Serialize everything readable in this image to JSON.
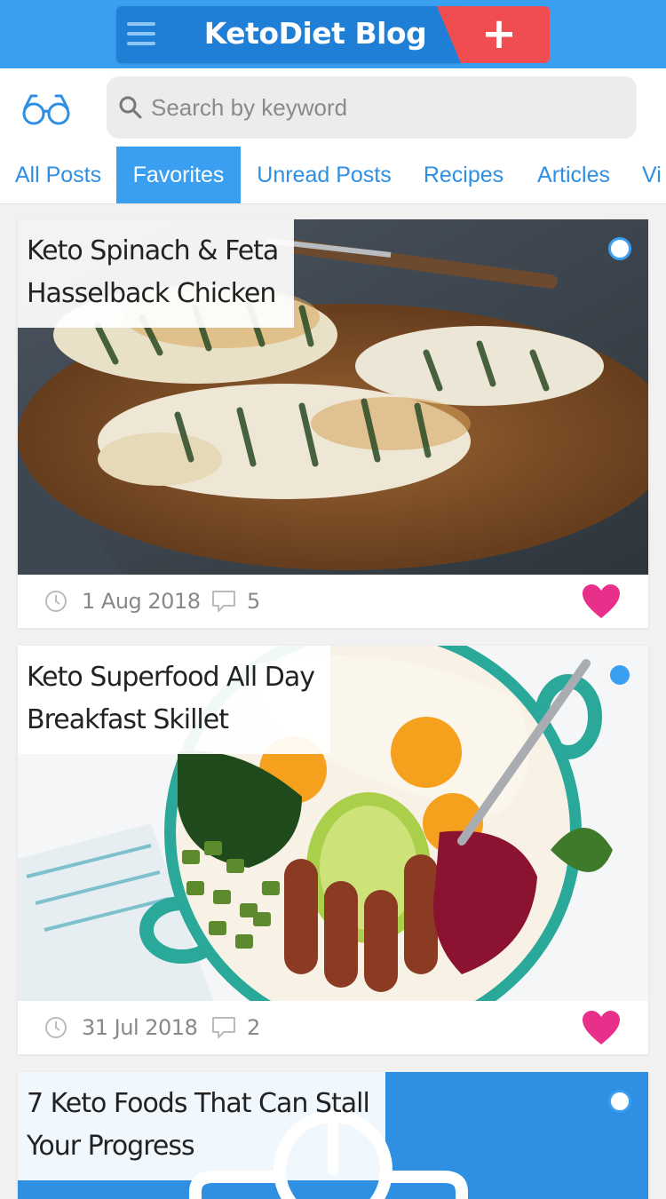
{
  "header": {
    "title": "KetoDiet Blog",
    "add_label": "+",
    "menu_icon": "hamburger-menu-icon",
    "colors": {
      "bar": "#3a9ff0",
      "title_bg": "#1f7fd6",
      "add_bg": "#ef4d50"
    }
  },
  "search": {
    "placeholder": "Search by keyword",
    "value": "",
    "left_icon": "glasses-icon",
    "icon": "search-icon"
  },
  "tabs": [
    {
      "label": "All Posts",
      "active": false
    },
    {
      "label": "Favorites",
      "active": true
    },
    {
      "label": "Unread Posts",
      "active": false
    },
    {
      "label": "Recipes",
      "active": false
    },
    {
      "label": "Articles",
      "active": false
    },
    {
      "label": "Vi",
      "active": false
    }
  ],
  "posts": [
    {
      "title": "Keto Spinach & Feta\nHasselback Chicken",
      "date": "1 Aug 2018",
      "comments": "5",
      "favorite": true,
      "unread": false,
      "image": "hasselback-chicken-photo"
    },
    {
      "title": "Keto Superfood All Day\nBreakfast Skillet",
      "date": "31 Jul 2018",
      "comments": "2",
      "favorite": true,
      "unread": true,
      "image": "breakfast-skillet-photo"
    },
    {
      "title": "7 Keto Foods That Can Stall\nYour Progress",
      "unread": false,
      "image": "scale-illustration"
    }
  ],
  "colors": {
    "accent": "#3a9ff0",
    "heart": "#e8308a"
  }
}
